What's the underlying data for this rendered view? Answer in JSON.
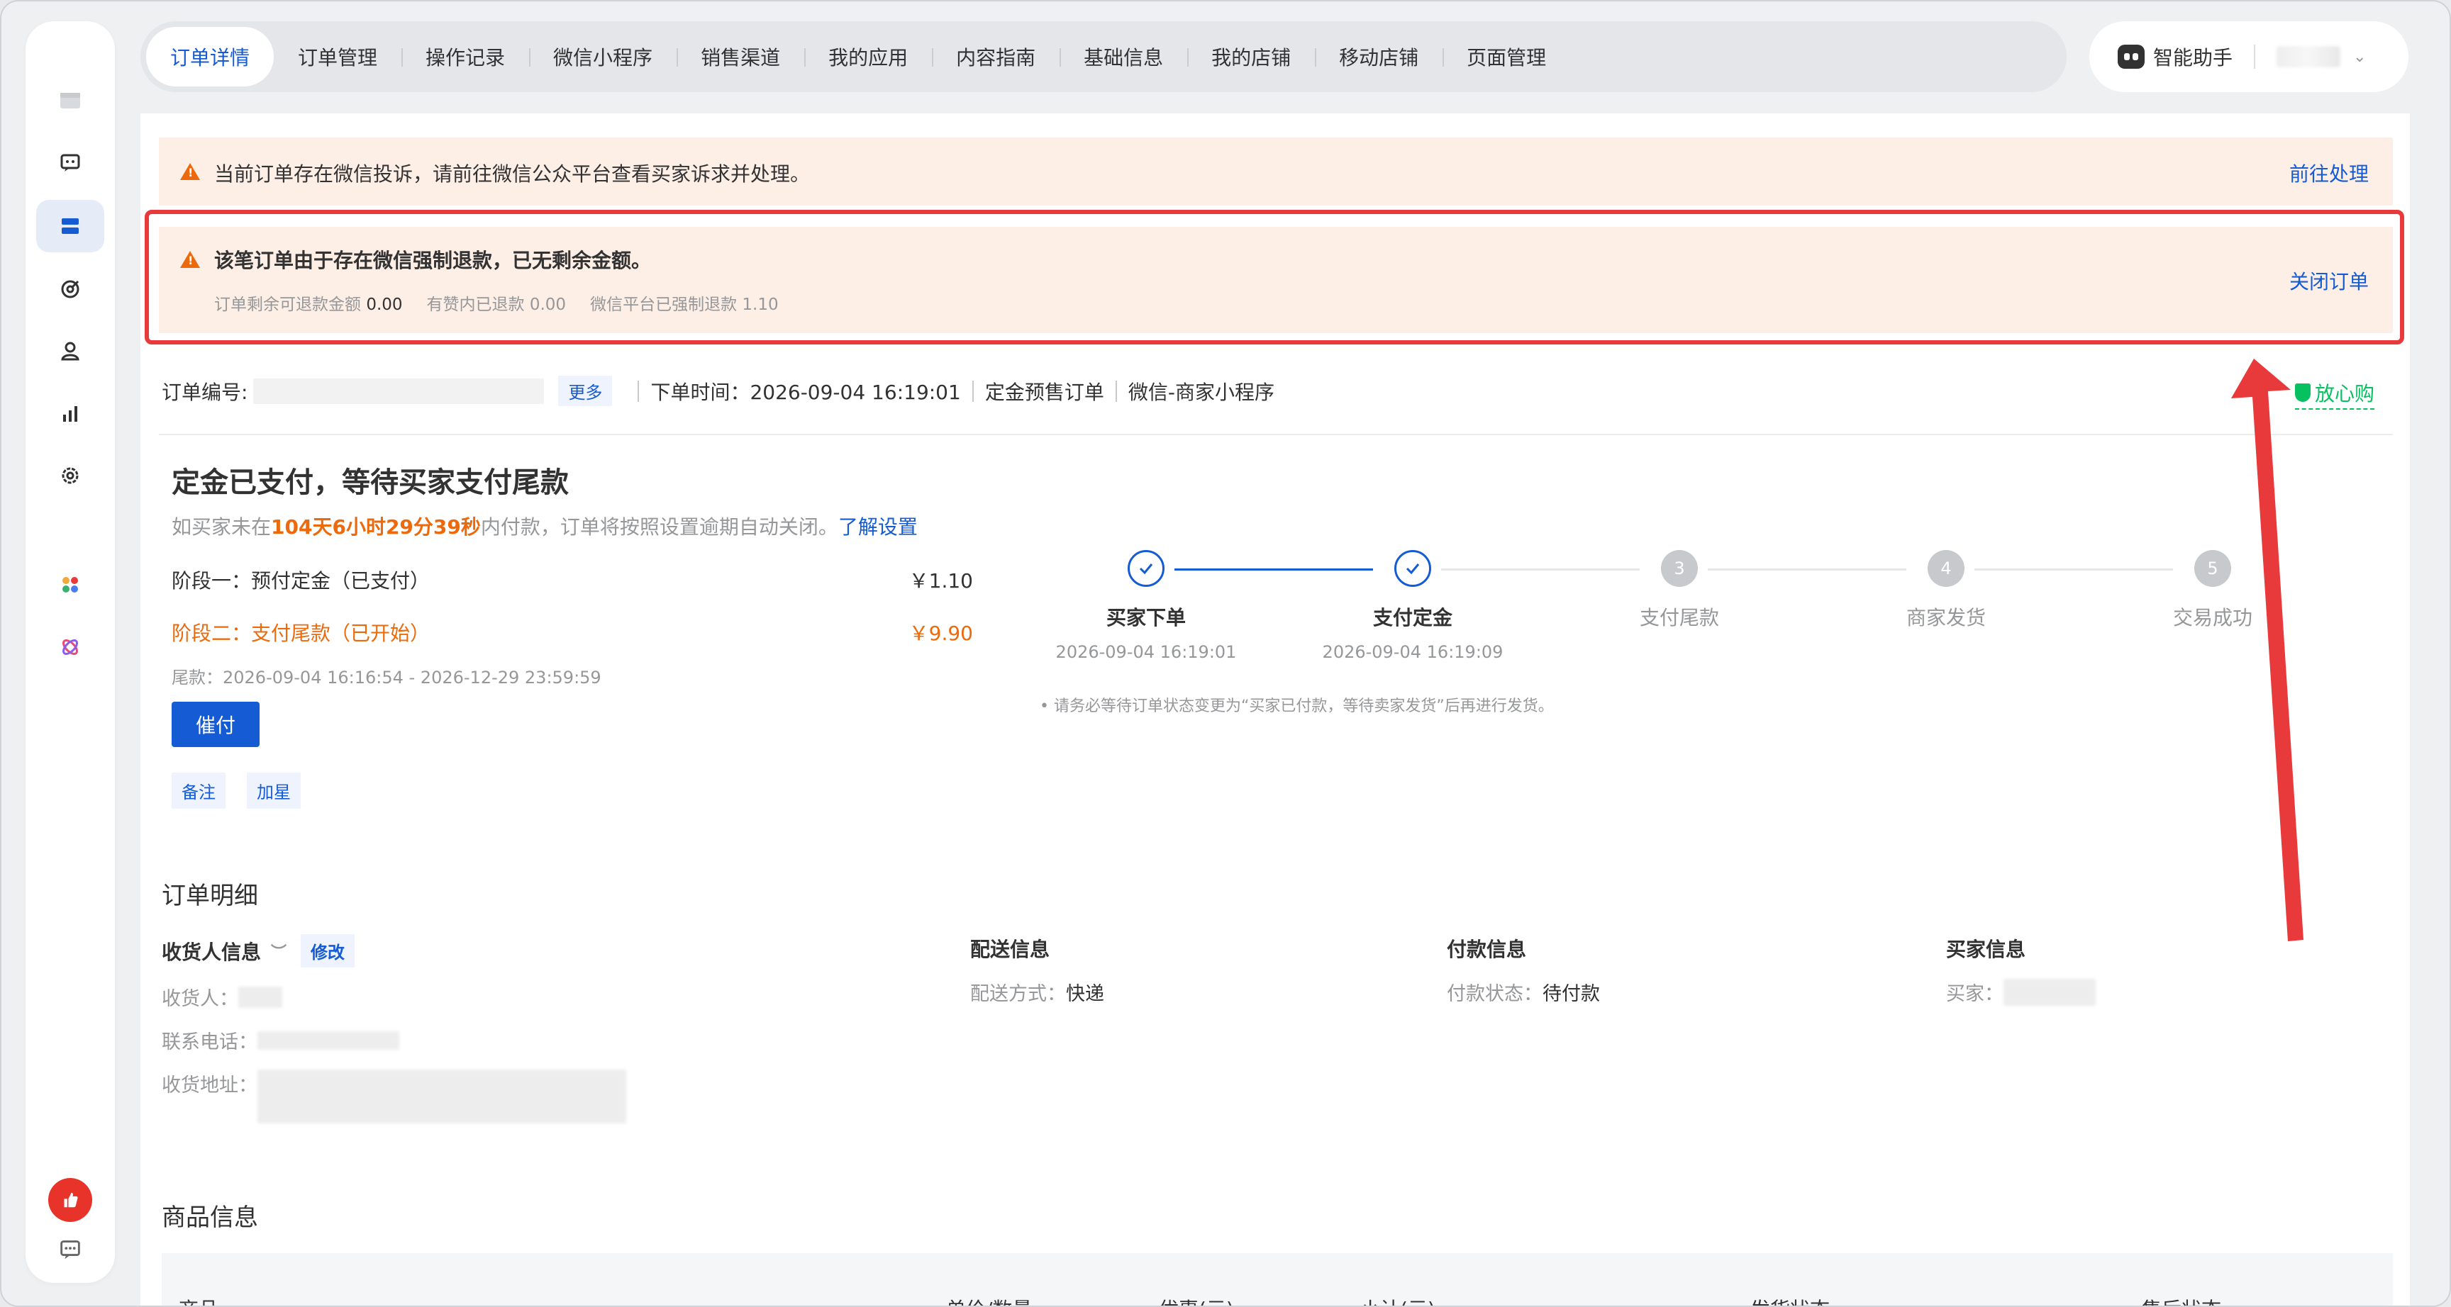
{
  "tabs": [
    "订单详情",
    "订单管理",
    "操作记录",
    "微信小程序",
    "销售渠道",
    "我的应用",
    "内容指南",
    "基础信息",
    "我的店铺",
    "移动店铺",
    "页面管理"
  ],
  "assistant": {
    "label": "智能助手"
  },
  "alerts": {
    "complaint": {
      "message": "当前订单存在微信投诉，请前往微信公众平台查看买家诉求并处理。",
      "action": "前往处理"
    },
    "refund": {
      "message": "该笔订单由于存在微信强制退款，已无剩余金额。",
      "remaining_label": "订单剩余可退款金额",
      "remaining_value": "0.00",
      "yz_label": "有赞内已退款",
      "yz_value": "0.00",
      "wx_label": "微信平台已强制退款",
      "wx_value": "1.10",
      "action": "关闭订单"
    }
  },
  "order": {
    "no_label": "订单编号:",
    "more": "更多",
    "time": "下单时间：2026-09-04 16:19:01",
    "type": "定金预售订单",
    "channel": "微信-商家小程序",
    "badge": "放心购"
  },
  "status": {
    "title": "定金已支付，等待买家支付尾款",
    "desc_prefix": "如买家未在",
    "countdown": "104天6小时29分39秒",
    "desc_suffix": "内付款，订单将按照设置逾期自动关闭。",
    "desc_link": "了解设置",
    "stage1_label": "阶段一：预付定金（已支付）",
    "stage1_amount": "￥1.10",
    "stage2_label": "阶段二：支付尾款（已开始）",
    "stage2_amount": "￥9.90",
    "final_time": "尾款：2026-09-04 16:16:54 - 2026-12-29 23:59:59",
    "urge": "催付",
    "remark": "备注",
    "star": "加星"
  },
  "steps": [
    {
      "num": "",
      "label": "买家下单",
      "time": "2026-09-04 16:19:01",
      "done": true
    },
    {
      "num": "",
      "label": "支付定金",
      "time": "2026-09-04 16:19:09",
      "done": true
    },
    {
      "num": "3",
      "label": "支付尾款",
      "time": "",
      "done": false
    },
    {
      "num": "4",
      "label": "商家发货",
      "time": "",
      "done": false
    },
    {
      "num": "5",
      "label": "交易成功",
      "time": "",
      "done": false
    }
  ],
  "steps_note": "• 请务必等待订单状态变更为“买家已付款，等待卖家发货”后再进行发货。",
  "detail": {
    "title": "订单明细",
    "receiver": {
      "title": "收货人信息",
      "edit": "修改",
      "name_label": "收货人：",
      "phone_label": "联系电话：",
      "address_label": "收货地址："
    },
    "delivery": {
      "title": "配送信息",
      "method_label": "配送方式：",
      "method": "快递"
    },
    "payment": {
      "title": "付款信息",
      "status_label": "付款状态：",
      "status": "待付款"
    },
    "buyer": {
      "title": "买家信息",
      "buyer_label": "买家："
    }
  },
  "goods": {
    "title": "商品信息",
    "columns": [
      "商品",
      "单价/数量",
      "优惠(元)",
      "小计(元)",
      "发货状态",
      "售后状态"
    ]
  },
  "colors": {
    "primary": "#155bd4",
    "warning": "#ed6a0c",
    "alert_bg": "#fdeee6",
    "annotation": "#e8393b",
    "success": "#07c160"
  }
}
